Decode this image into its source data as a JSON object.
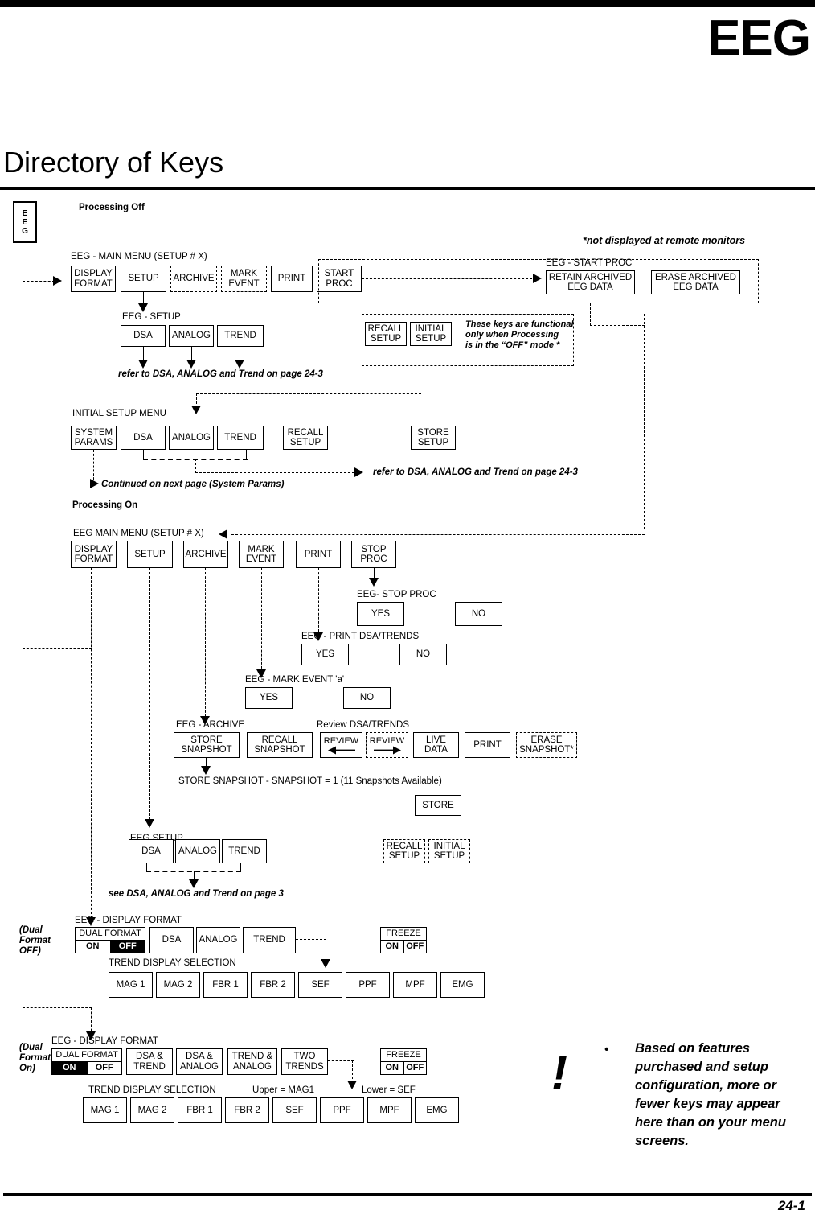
{
  "page": {
    "header_title": "EEG",
    "doc_title": "Directory of Keys",
    "page_number": "24-1",
    "tab_letters": [
      "E",
      "E",
      "G"
    ]
  },
  "processing_off": {
    "heading": "Processing Off",
    "remote_note": "*not displayed at remote monitors",
    "main_menu": {
      "label": "EEG - MAIN MENU (SETUP # X)",
      "keys": [
        {
          "line1": "DISPLAY",
          "line2": "FORMAT",
          "style": "solid"
        },
        {
          "line1": "SETUP",
          "line2": "",
          "style": "solid"
        },
        {
          "line1": "ARCHIVE",
          "line2": "",
          "style": "dashed"
        },
        {
          "line1": "MARK",
          "line2": "EVENT",
          "style": "dashed"
        },
        {
          "line1": "PRINT",
          "line2": "",
          "style": "solid"
        },
        {
          "line1": "START",
          "line2": "PROC",
          "style": "solid"
        }
      ]
    },
    "setup_menu": {
      "label": "EEG - SETUP",
      "keys": [
        {
          "line1": "DSA",
          "line2": ""
        },
        {
          "line1": "ANALOG",
          "line2": ""
        },
        {
          "line1": "TREND",
          "line2": ""
        }
      ],
      "footnote": "refer to DSA, ANALOG and Trend on page 24-3"
    },
    "start_proc": {
      "label": "EEG - START PROC",
      "keys": [
        {
          "line1": "RETAIN ARCHIVED",
          "line2": "EEG DATA"
        },
        {
          "line1": "ERASE ARCHIVED",
          "line2": "EEG DATA"
        }
      ]
    },
    "off_mode_group": {
      "keys": [
        {
          "line1": "RECALL",
          "line2": "SETUP"
        },
        {
          "line1": "INITIAL",
          "line2": "SETUP"
        }
      ],
      "note_lines": [
        "These keys are functional",
        "only when Processing",
        "is in the “OFF” mode *"
      ]
    },
    "initial_setup_menu": {
      "label": "INITIAL SETUP MENU",
      "keys": [
        {
          "line1": "SYSTEM",
          "line2": "PARAMS"
        },
        {
          "line1": "DSA",
          "line2": ""
        },
        {
          "line1": "ANALOG",
          "line2": ""
        },
        {
          "line1": "TREND",
          "line2": ""
        },
        {
          "line1": "RECALL",
          "line2": "SETUP"
        },
        {
          "line1": "STORE",
          "line2": "SETUP"
        }
      ],
      "footnote_right": "refer to DSA, ANALOG and Trend on page 24-3",
      "footnote_left": "Continued on next page (System Params)"
    }
  },
  "processing_on": {
    "heading": "Processing On",
    "main_menu": {
      "label": "EEG MAIN MENU (SETUP # X)",
      "keys": [
        {
          "line1": "DISPLAY",
          "line2": "FORMAT"
        },
        {
          "line1": "SETUP",
          "line2": ""
        },
        {
          "line1": "ARCHIVE",
          "line2": ""
        },
        {
          "line1": "MARK",
          "line2": "EVENT"
        },
        {
          "line1": "PRINT",
          "line2": ""
        },
        {
          "line1": "STOP",
          "line2": "PROC"
        }
      ]
    },
    "stop_proc": {
      "label": "EEG- STOP PROC",
      "keys": [
        {
          "line1": "YES"
        },
        {
          "line1": "NO"
        }
      ]
    },
    "print_dsa": {
      "label": "EEG - PRINT DSA/TRENDS",
      "keys": [
        {
          "line1": "YES"
        },
        {
          "line1": "NO"
        }
      ]
    },
    "mark_event": {
      "label": "EEG - MARK EVENT 'a'",
      "keys": [
        {
          "line1": "YES"
        },
        {
          "line1": "NO"
        }
      ]
    },
    "archive": {
      "label": "EEG - ARCHIVE",
      "review_label": "Review DSA/TRENDS",
      "keys": [
        {
          "line1": "STORE",
          "line2": "SNAPSHOT",
          "style": "solid"
        },
        {
          "line1": "RECALL",
          "line2": "SNAPSHOT",
          "style": "solid"
        },
        {
          "line1": "REVIEW",
          "line2": "",
          "icon": "arrow-left",
          "style": "solid"
        },
        {
          "line1": "REVIEW",
          "line2": "",
          "icon": "arrow-right",
          "style": "dashed"
        },
        {
          "line1": "LIVE",
          "line2": "DATA",
          "style": "solid"
        },
        {
          "line1": "PRINT",
          "line2": "",
          "style": "solid"
        },
        {
          "line1": "ERASE",
          "line2": "SNAPSHOT*",
          "style": "dashed"
        }
      ],
      "snapshot_label": "STORE SNAPSHOT - SNAPSHOT = 1 (11 Snapshots Available)",
      "store_key": {
        "line1": "STORE"
      }
    },
    "setup": {
      "label": "EEG SETUP",
      "keys": [
        {
          "line1": "DSA",
          "line2": ""
        },
        {
          "line1": "ANALOG",
          "line2": ""
        },
        {
          "line1": "TREND",
          "line2": ""
        }
      ],
      "footnote": "see DSA, ANALOG and Trend on page 3",
      "side_keys": [
        {
          "line1": "RECALL",
          "line2": "SETUP"
        },
        {
          "line1": "INITIAL",
          "line2": "SETUP"
        }
      ]
    },
    "display_format_off": {
      "side_note": [
        "(Dual",
        "Format",
        "OFF)"
      ],
      "label": "EEG - DISPLAY FORMAT",
      "dual_format": {
        "header": "DUAL FORMAT",
        "options": [
          "ON",
          "OFF"
        ],
        "selected": "OFF"
      },
      "keys": [
        {
          "line1": "DSA",
          "line2": ""
        },
        {
          "line1": "ANALOG",
          "line2": ""
        },
        {
          "line1": "TREND",
          "line2": ""
        }
      ],
      "freeze": {
        "header": "FREEZE",
        "options": [
          "ON",
          "OFF"
        ],
        "selected": ""
      },
      "trend_label": "TREND DISPLAY SELECTION",
      "trend_keys": [
        "MAG 1",
        "MAG 2",
        "FBR 1",
        "FBR 2",
        "SEF",
        "PPF",
        "MPF",
        "EMG"
      ]
    },
    "display_format_on": {
      "side_note": [
        "(Dual",
        "Format",
        "On)"
      ],
      "label": "EEG - DISPLAY FORMAT",
      "dual_format": {
        "header": "DUAL FORMAT",
        "options": [
          "ON",
          "OFF"
        ],
        "selected": "ON"
      },
      "keys": [
        {
          "line1": "DSA &",
          "line2": "TREND"
        },
        {
          "line1": "DSA &",
          "line2": "ANALOG"
        },
        {
          "line1": "TREND &",
          "line2": "ANALOG"
        },
        {
          "line1": "TWO",
          "line2": "TRENDS"
        }
      ],
      "freeze": {
        "header": "FREEZE",
        "options": [
          "ON",
          "OFF"
        ],
        "selected": ""
      },
      "trend_label": "TREND DISPLAY SELECTION",
      "upper_label": "Upper = MAG1",
      "lower_label": "Lower = SEF",
      "trend_keys": [
        "MAG 1",
        "MAG 2",
        "FBR 1",
        "FBR 2",
        "SEF",
        "PPF",
        "MPF",
        "EMG"
      ]
    }
  },
  "note": {
    "icon": "!",
    "bullet": "•",
    "text": "Based on features purchased and setup configuration, more or fewer keys may appear here than on your menu screens."
  }
}
